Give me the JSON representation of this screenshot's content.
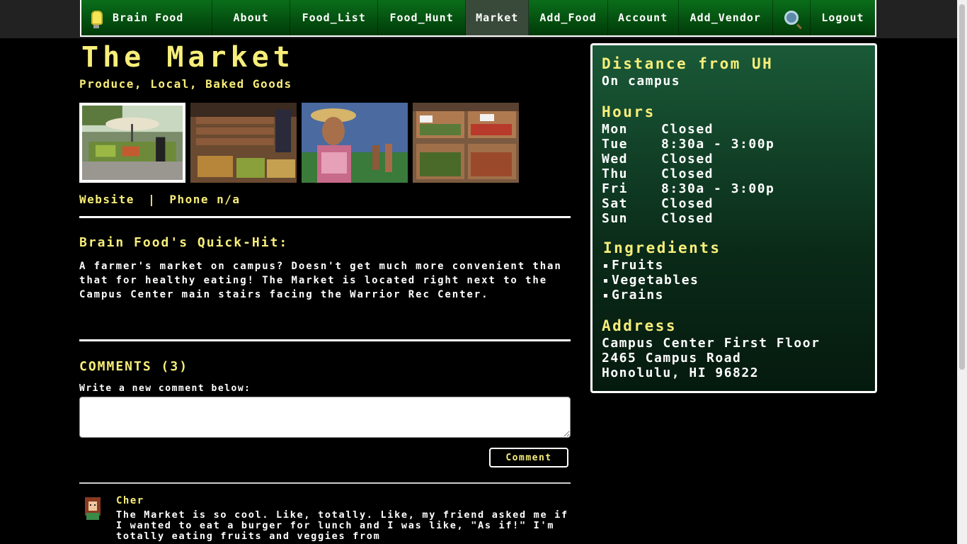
{
  "nav": {
    "brand": "Brain Food",
    "items": [
      "About",
      "Food_List",
      "Food_Hunt",
      "Market",
      "Add_Food",
      "Account",
      "Add_Vendor"
    ],
    "active": "Market",
    "search_icon": "magnifier-icon",
    "logout": "Logout"
  },
  "page": {
    "title": "The Market",
    "subtitle": "Produce, Local, Baked Goods",
    "images": [
      "market-stalls-photo",
      "produce-bins-photo",
      "mural-photo",
      "vegetable-crates-photo"
    ],
    "website": "Website",
    "separator": "|",
    "phone": "Phone n/a"
  },
  "quickhit": {
    "title": "Brain Food's Quick-Hit:",
    "text": "A farmer's market on campus? Doesn't get much more convenient than that for healthy eating! The Market is located right next to the Campus Center main stairs facing the Warrior Rec Center."
  },
  "comments": {
    "title": "COMMENTS (3)",
    "write_label": "Write a new comment below:",
    "button": "Comment",
    "items": [
      {
        "author": "Cher",
        "text": "The Market is so cool. Like, totally. Like, my friend asked me if I wanted to eat a burger for lunch and I was like, \"As if!\" I'm totally eating fruits and veggies from"
      }
    ]
  },
  "sidebar": {
    "distance_title": "Distance from UH",
    "distance_value": "On campus",
    "hours_title": "Hours",
    "hours": [
      {
        "day": "Mon",
        "time": "Closed"
      },
      {
        "day": "Tue",
        "time": "8:30a - 3:00p"
      },
      {
        "day": "Wed",
        "time": "Closed"
      },
      {
        "day": "Thu",
        "time": "Closed"
      },
      {
        "day": "Fri",
        "time": "8:30a - 3:00p"
      },
      {
        "day": "Sat",
        "time": "Closed"
      },
      {
        "day": "Sun",
        "time": "Closed"
      }
    ],
    "ingredients_title": "Ingredients",
    "ingredients": [
      "Fruits",
      "Vegetables",
      "Grains"
    ],
    "address_title": "Address",
    "address": [
      "Campus Center First Floor",
      "2465 Campus Road",
      "Honolulu, HI 96822"
    ]
  },
  "colors": {
    "accent_yellow": "#f7ee7a",
    "nav_green": "#0a6e1a",
    "panel_green": "#1a5a38"
  }
}
